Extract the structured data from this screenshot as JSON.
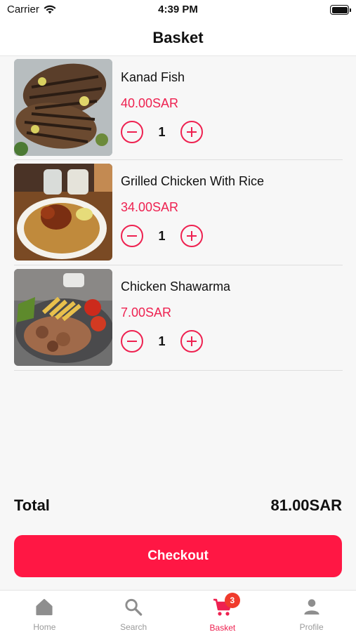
{
  "status": {
    "carrier": "Carrier",
    "time": "4:39 PM"
  },
  "header": {
    "title": "Basket"
  },
  "items": [
    {
      "name": "Kanad Fish",
      "price": "40.00SAR",
      "qty": "1"
    },
    {
      "name": "Grilled Chicken With Rice",
      "price": "34.00SAR",
      "qty": "1"
    },
    {
      "name": "Chicken Shawarma",
      "price": "7.00SAR",
      "qty": "1"
    }
  ],
  "total": {
    "label": "Total",
    "value": "81.00SAR"
  },
  "checkout": {
    "label": "Checkout"
  },
  "tabs": [
    {
      "label": "Home",
      "icon": "home-icon"
    },
    {
      "label": "Search",
      "icon": "search-icon"
    },
    {
      "label": "Basket",
      "icon": "cart-icon",
      "badge": "3",
      "active": true
    },
    {
      "label": "Profile",
      "icon": "person-icon"
    }
  ],
  "colors": {
    "accent": "#ee2150",
    "button": "#ff1744",
    "badge": "#f03b2c"
  }
}
